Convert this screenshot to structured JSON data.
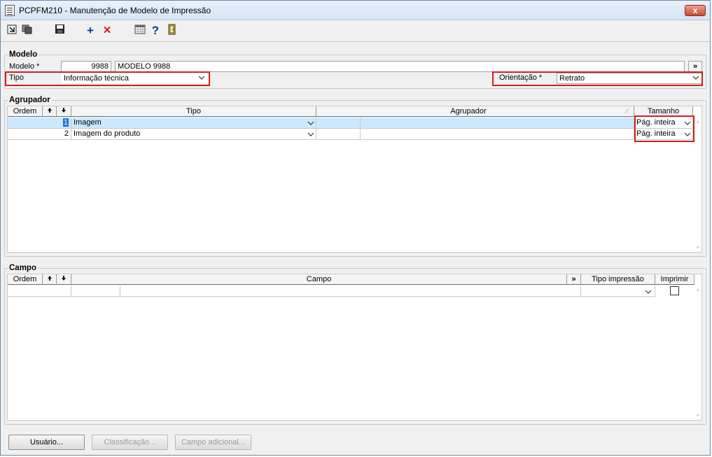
{
  "window": {
    "title": "PCPFM210 - Manutenção de Modelo de Impressão",
    "close_label": "x"
  },
  "toolbar": {
    "icons": [
      "export-icon",
      "copy-icon",
      "save-icon",
      "add-icon",
      "delete-icon",
      "calendar-grid-icon",
      "help-icon",
      "exit-door-icon"
    ],
    "add_glyph": "+",
    "delete_glyph": "✕",
    "help_glyph": "?"
  },
  "modelo": {
    "section_label": "Modelo",
    "modelo_label": "Modelo *",
    "modelo_code": "9988",
    "modelo_name": "MODELO 9988",
    "more_button": "»",
    "tipo_label": "Tipo",
    "tipo_value": "Informação técnica",
    "orientacao_label": "Orientação *",
    "orientacao_value": "Retrato"
  },
  "agrupador": {
    "section_label": "Agrupador",
    "columns": {
      "ordem": "Ordem",
      "tipo": "Tipo",
      "agrupador": "Agrupador",
      "tamanho": "Tamanho"
    },
    "rows": [
      {
        "ordem": "1",
        "tipo": "Imagem",
        "agrupador": "",
        "tamanho": "Pág. inteira"
      },
      {
        "ordem": "2",
        "tipo": "Imagem do produto",
        "agrupador": "",
        "tamanho": "Pág. inteira"
      }
    ]
  },
  "campo": {
    "section_label": "Campo",
    "columns": {
      "ordem": "Ordem",
      "campo": "Campo",
      "more": "»",
      "tipo_impressao": "Tipo impressão",
      "imprimir": "Imprimir"
    }
  },
  "buttons": {
    "usuario": "Usuário...",
    "classificacao": "Classificação...",
    "campo_adicional": "Campo adicional..."
  },
  "colors": {
    "highlight": "#cce8ff",
    "annotation": "#d41e1e",
    "accent_blue": "#0a3c9c"
  }
}
